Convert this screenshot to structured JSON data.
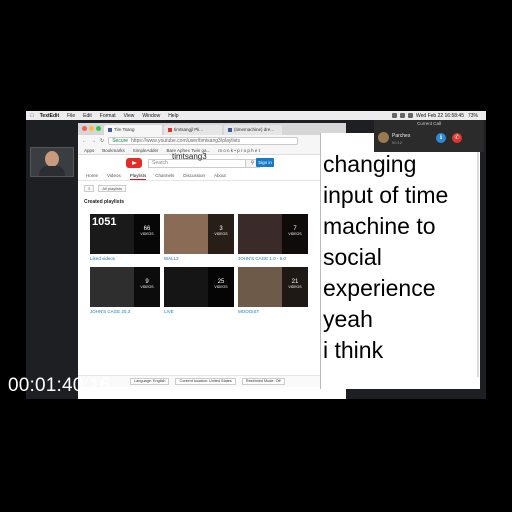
{
  "menubar": {
    "app": "TextEdit",
    "items": [
      "File",
      "Edit",
      "Format",
      "View",
      "Window",
      "Help"
    ],
    "clock": "Wed Feb 22  16:58:45",
    "battery": "73%"
  },
  "browser": {
    "tabs": [
      "Tim Tsang",
      "timtsangjl Pli...",
      "(timemachine) dre..."
    ],
    "url_secure": "Secure",
    "url": "https://www.youtube.com/user/timtsang3/playlists",
    "bookmarks": [
      "Apps",
      "Bookmarks",
      "SimpleAdder",
      "Bare Aphex Twin ga...",
      "m o n k • p r o p h e t"
    ],
    "channel_name": "timtsang3",
    "search_placeholder": "Search",
    "signin": "Sign in",
    "nav": [
      "Home",
      "Videos",
      "Playlists",
      "Channels",
      "Discussion",
      "About"
    ],
    "filter_chip": "All playlists",
    "created_heading": "Created playlists",
    "playlists": [
      {
        "title": "Liked videos",
        "count": "66",
        "videos_label": "VIDEOS",
        "thumb_text": "1051"
      },
      {
        "title": "WALL2",
        "count": "3",
        "videos_label": "VIDEOS",
        "thumb_text": ""
      },
      {
        "title": "JOHN'S CAGE 1.0 - 9.0",
        "count": "7",
        "videos_label": "VIDEOS",
        "thumb_text": ""
      },
      {
        "title": "JOHN'S CAGE 20.3",
        "count": "9",
        "videos_label": "VIDEOS",
        "thumb_text": ""
      },
      {
        "title": "LIVE",
        "count": "25",
        "videos_label": "VIDEOS",
        "thumb_text": ""
      },
      {
        "title": "MOOGIST",
        "count": "21",
        "videos_label": "VIDEOS",
        "thumb_text": ""
      }
    ],
    "footer": [
      "Language: English",
      "Content location: United States",
      "Restricted Mode: Off"
    ]
  },
  "call": {
    "header": "Current Call",
    "name": "Parches",
    "sub": "00:12"
  },
  "caption_lines": [
    "changing",
    "input of time",
    "machine to",
    "social",
    "experience",
    "yeah",
    "i think"
  ],
  "timecode": "00:01:40;16",
  "colors": {
    "youtube_red": "#e52d27",
    "link_blue": "#167ac6",
    "call_end": "#e0342e",
    "call_info": "#2d89d6"
  }
}
